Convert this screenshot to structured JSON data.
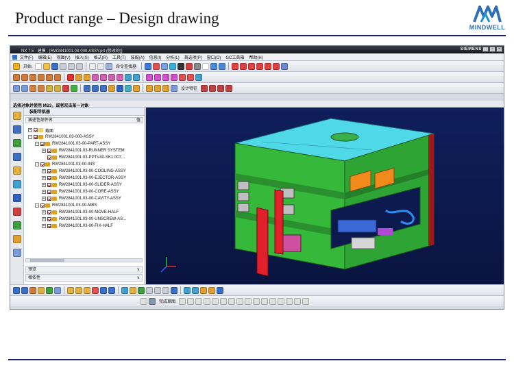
{
  "slide": {
    "title": "Product range – Design drawing"
  },
  "logo": {
    "text": "MINDWELL"
  },
  "window": {
    "title": "NX 7.5 - 建模 - [RW2841001.03-000-ASSY.prt (修改的)]",
    "brand": "SIEMENS",
    "controls": [
      "_",
      "▫",
      "×"
    ]
  },
  "menu": [
    "文件(F)",
    "编辑(E)",
    "视图(V)",
    "插入(S)",
    "格式(R)",
    "工具(T)",
    "装配(A)",
    "信息(I)",
    "分析(L)",
    "首选项(P)",
    "窗口(O)",
    "GC工具箱",
    "帮助(H)"
  ],
  "toolbar": {
    "start_label": "开始",
    "command_finder": "命令查找器",
    "design_feature": "设计特征"
  },
  "status_prompt": "选择对象并使用 MB3，或者双击某一对象",
  "navigator": {
    "title": "装配导航器",
    "column_header": "描述性部件名",
    "column_extra": "值",
    "tree": [
      {
        "label": "截面",
        "depth": 0
      },
      {
        "label": "RW2841001.03-000-ASSY",
        "depth": 0
      },
      {
        "label": "RW2841001.03-00-PART-ASSY",
        "depth": 1
      },
      {
        "label": "RW2841001.03-RUNNER SYSTEM",
        "depth": 2
      },
      {
        "label": "RW2841001.03-PPTV40-SK1.007...",
        "depth": 2
      },
      {
        "label": "RW2841001.03-00-INS",
        "depth": 1
      },
      {
        "label": "RW2841001.03-00-COOLING-ASSY",
        "depth": 2
      },
      {
        "label": "RW2841001.03-00-EJECTOR-ASSY",
        "depth": 2
      },
      {
        "label": "RW2841001.03-00-SLIDER-ASSY",
        "depth": 2
      },
      {
        "label": "RW2841001.03-00-CORE-ASSY",
        "depth": 2
      },
      {
        "label": "RW2841001.03-00-CAVITY-ASSY",
        "depth": 2
      },
      {
        "label": "RW2841001.03-00-MBS",
        "depth": 1
      },
      {
        "label": "RW2841001.03-00-MOVE-HALF",
        "depth": 2
      },
      {
        "label": "RW2841001.03-00-UNSCREW-AS...",
        "depth": 2
      },
      {
        "label": "RW2841001.03-00-FIX-HALF",
        "depth": 2
      }
    ],
    "section_preview": "预览",
    "section_deps": "相依性"
  },
  "sketch_label": "完成草图",
  "colors": {
    "slide_rule": "#1b1f6e",
    "logo_blue": "#2f6fb5",
    "viewport_bg": "#0f1f5c",
    "mold_top": "#4fd8e8",
    "mold_body": "#36b83a",
    "mold_red": "#e0202a",
    "mold_orange": "#f08a1a",
    "mold_pink": "#d050a0"
  }
}
